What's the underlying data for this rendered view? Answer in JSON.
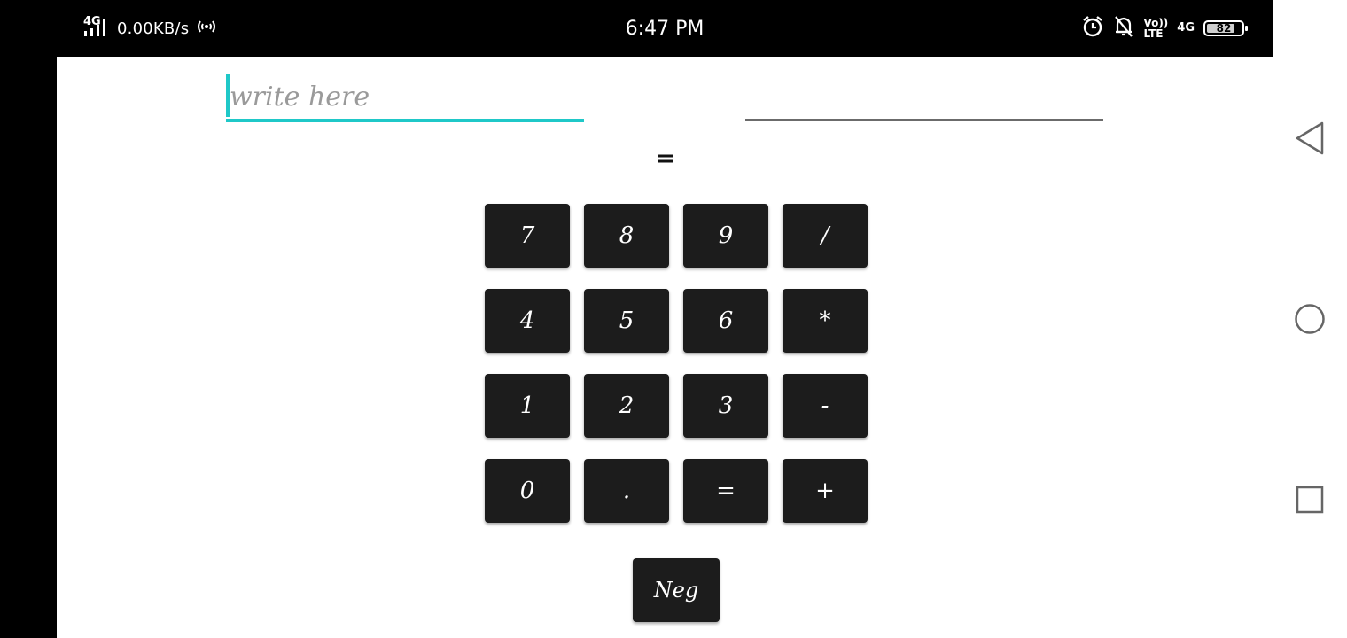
{
  "status_bar": {
    "network_type": "4G",
    "net_speed": "0.00KB/s",
    "time": "6:47 PM",
    "volte_top": "Vo))",
    "volte_bottom": "LTE",
    "secondary_network": "4G",
    "battery_level": "82",
    "battery_fraction": 0.82,
    "icons": [
      "signal-icon",
      "hotspot-icon",
      "alarm-icon",
      "notifications-off-icon",
      "volte-icon",
      "battery-icon"
    ]
  },
  "calculator": {
    "input_placeholder": "write here",
    "input_value": "",
    "result": "",
    "equals_display": "=",
    "accent_color": "#1fc8c8",
    "keys": {
      "k7": "7",
      "k8": "8",
      "k9": "9",
      "kdiv": "/",
      "k4": "4",
      "k5": "5",
      "k6": "6",
      "kmul": "*",
      "k1": "1",
      "k2": "2",
      "k3": "3",
      "ksub": "-",
      "k0": "0",
      "kdot": ".",
      "keq": "=",
      "kadd": "+",
      "kneg": "Neg"
    }
  },
  "navigation": {
    "buttons": [
      "back-icon",
      "home-icon",
      "recents-icon"
    ]
  }
}
